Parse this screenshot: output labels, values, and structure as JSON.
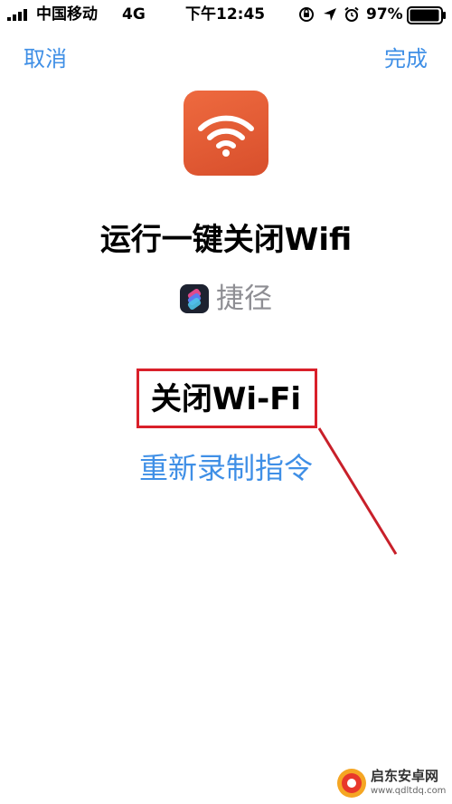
{
  "status_bar": {
    "carrier": "中国移动",
    "network": "4G",
    "time": "下午12:45",
    "battery_percent": "97%",
    "icons": [
      "signal-bars-icon",
      "orientation-lock-icon",
      "location-arrow-icon",
      "alarm-clock-icon",
      "battery-icon"
    ],
    "battery_level": 0.97
  },
  "nav": {
    "cancel_label": "取消",
    "done_label": "完成"
  },
  "shortcut": {
    "icon": "wifi-icon",
    "icon_color": "#e35d36",
    "title": "运行一键关闭Wifi",
    "app_name": "捷径",
    "app_icon": "shortcuts-app-icon"
  },
  "action": {
    "label": "关闭Wi-Fi",
    "rerecord_label": "重新录制指令"
  },
  "colors": {
    "accent": "#3f8fe6",
    "highlight": "#d9202a"
  },
  "watermark": {
    "name": "启东安卓网",
    "url": "www.qdltdq.com"
  }
}
